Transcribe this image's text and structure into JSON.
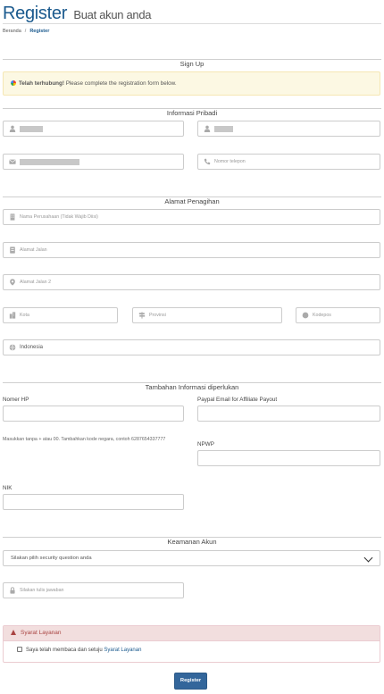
{
  "header": {
    "title": "Register",
    "subtitle": "Buat akun anda"
  },
  "breadcrumb": {
    "home": "Beranda",
    "separator": "/",
    "current": "Register"
  },
  "signup": {
    "section": "Sign Up",
    "alert_bold": "Telah terhubung!",
    "alert_text": " Please complete the registration form below."
  },
  "personal": {
    "section": "Informasi Pribadi",
    "phone_placeholder": "Nomor telepon"
  },
  "billing": {
    "section": "Alamat Penagihan",
    "company_placeholder": "Nama Perusahaan (Tidak Wajib Diisi)",
    "address1_placeholder": "Alamat Jalan",
    "address2_placeholder": "Alamat Jalan 2",
    "city_placeholder": "Kota",
    "state_placeholder": "Provinsi",
    "postcode_placeholder": "Kodepos",
    "country_value": "Indonesia"
  },
  "extra": {
    "section": "Tambahan Informasi diperlukan",
    "phone_label": "Nomer HP",
    "paypal_label": "Paypal Email for Affiliate Payout",
    "phone_help": "Masukkan tanpa + atau 00. Tambahkan kode negara, contoh 6287654337777",
    "npwp_label": "NPWP",
    "nik_label": "NIK"
  },
  "security": {
    "section": "Keamanan Akun",
    "question_selected": "Silakan pilih security question anda",
    "answer_placeholder": "Silakan tulis jawaban"
  },
  "tos": {
    "title": "Syarat Layanan",
    "text": "Saya telah membaca dan setuju ",
    "link": "Syarat Layanan"
  },
  "submit": {
    "label": "Register"
  },
  "colors": {
    "brand": "#1b5a8e",
    "button": "#33669b",
    "alert_bg": "#fcf8e3",
    "danger_bg": "#f2dede",
    "danger_text": "#a94442"
  },
  "icons": {
    "user": "user-icon",
    "email": "envelope-icon",
    "phone": "phone-icon",
    "building": "building-icon",
    "address": "address-card-icon",
    "pin": "map-marker-icon",
    "city": "city-icon",
    "state": "map-signs-icon",
    "postcode": "certificate-icon",
    "country": "globe-icon",
    "lock": "lock-icon",
    "warning": "warning-icon"
  }
}
